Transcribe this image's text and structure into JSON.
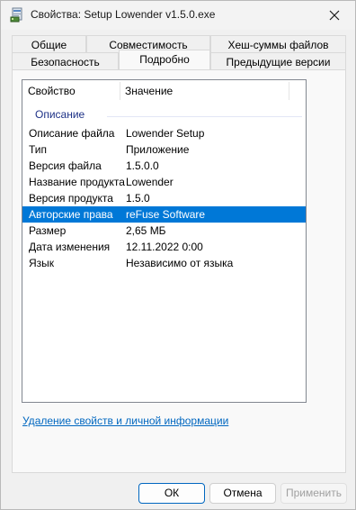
{
  "window": {
    "title": "Свойства: Setup Lowender v1.5.0.exe"
  },
  "tabs": {
    "row1": [
      "Общие",
      "Совместимость",
      "Хеш-суммы файлов"
    ],
    "row2": [
      "Безопасность",
      "Подробно",
      "Предыдущие версии"
    ],
    "active": "Подробно"
  },
  "details": {
    "header_property": "Свойство",
    "header_value": "Значение",
    "group_label": "Описание",
    "rows": [
      {
        "property": "Описание файла",
        "value": "Lowender Setup"
      },
      {
        "property": "Тип",
        "value": "Приложение"
      },
      {
        "property": "Версия файла",
        "value": "1.5.0.0"
      },
      {
        "property": "Название продукта",
        "value": "Lowender"
      },
      {
        "property": "Версия продукта",
        "value": "1.5.0"
      },
      {
        "property": "Авторские права",
        "value": "reFuse Software"
      },
      {
        "property": "Размер",
        "value": "2,65 МБ"
      },
      {
        "property": "Дата изменения",
        "value": "12.11.2022 0:00"
      },
      {
        "property": "Язык",
        "value": "Независимо от языка"
      }
    ],
    "selected_row": "Авторские права"
  },
  "link_text": "Удаление свойств и личной информации",
  "buttons": {
    "ok": "ОК",
    "cancel": "Отмена",
    "apply": "Применить"
  },
  "colors": {
    "selection": "#0078d7",
    "link": "#0067c0",
    "group_label": "#1e3287"
  },
  "icons": {
    "app": "setup-exe-icon",
    "close": "close-icon"
  }
}
